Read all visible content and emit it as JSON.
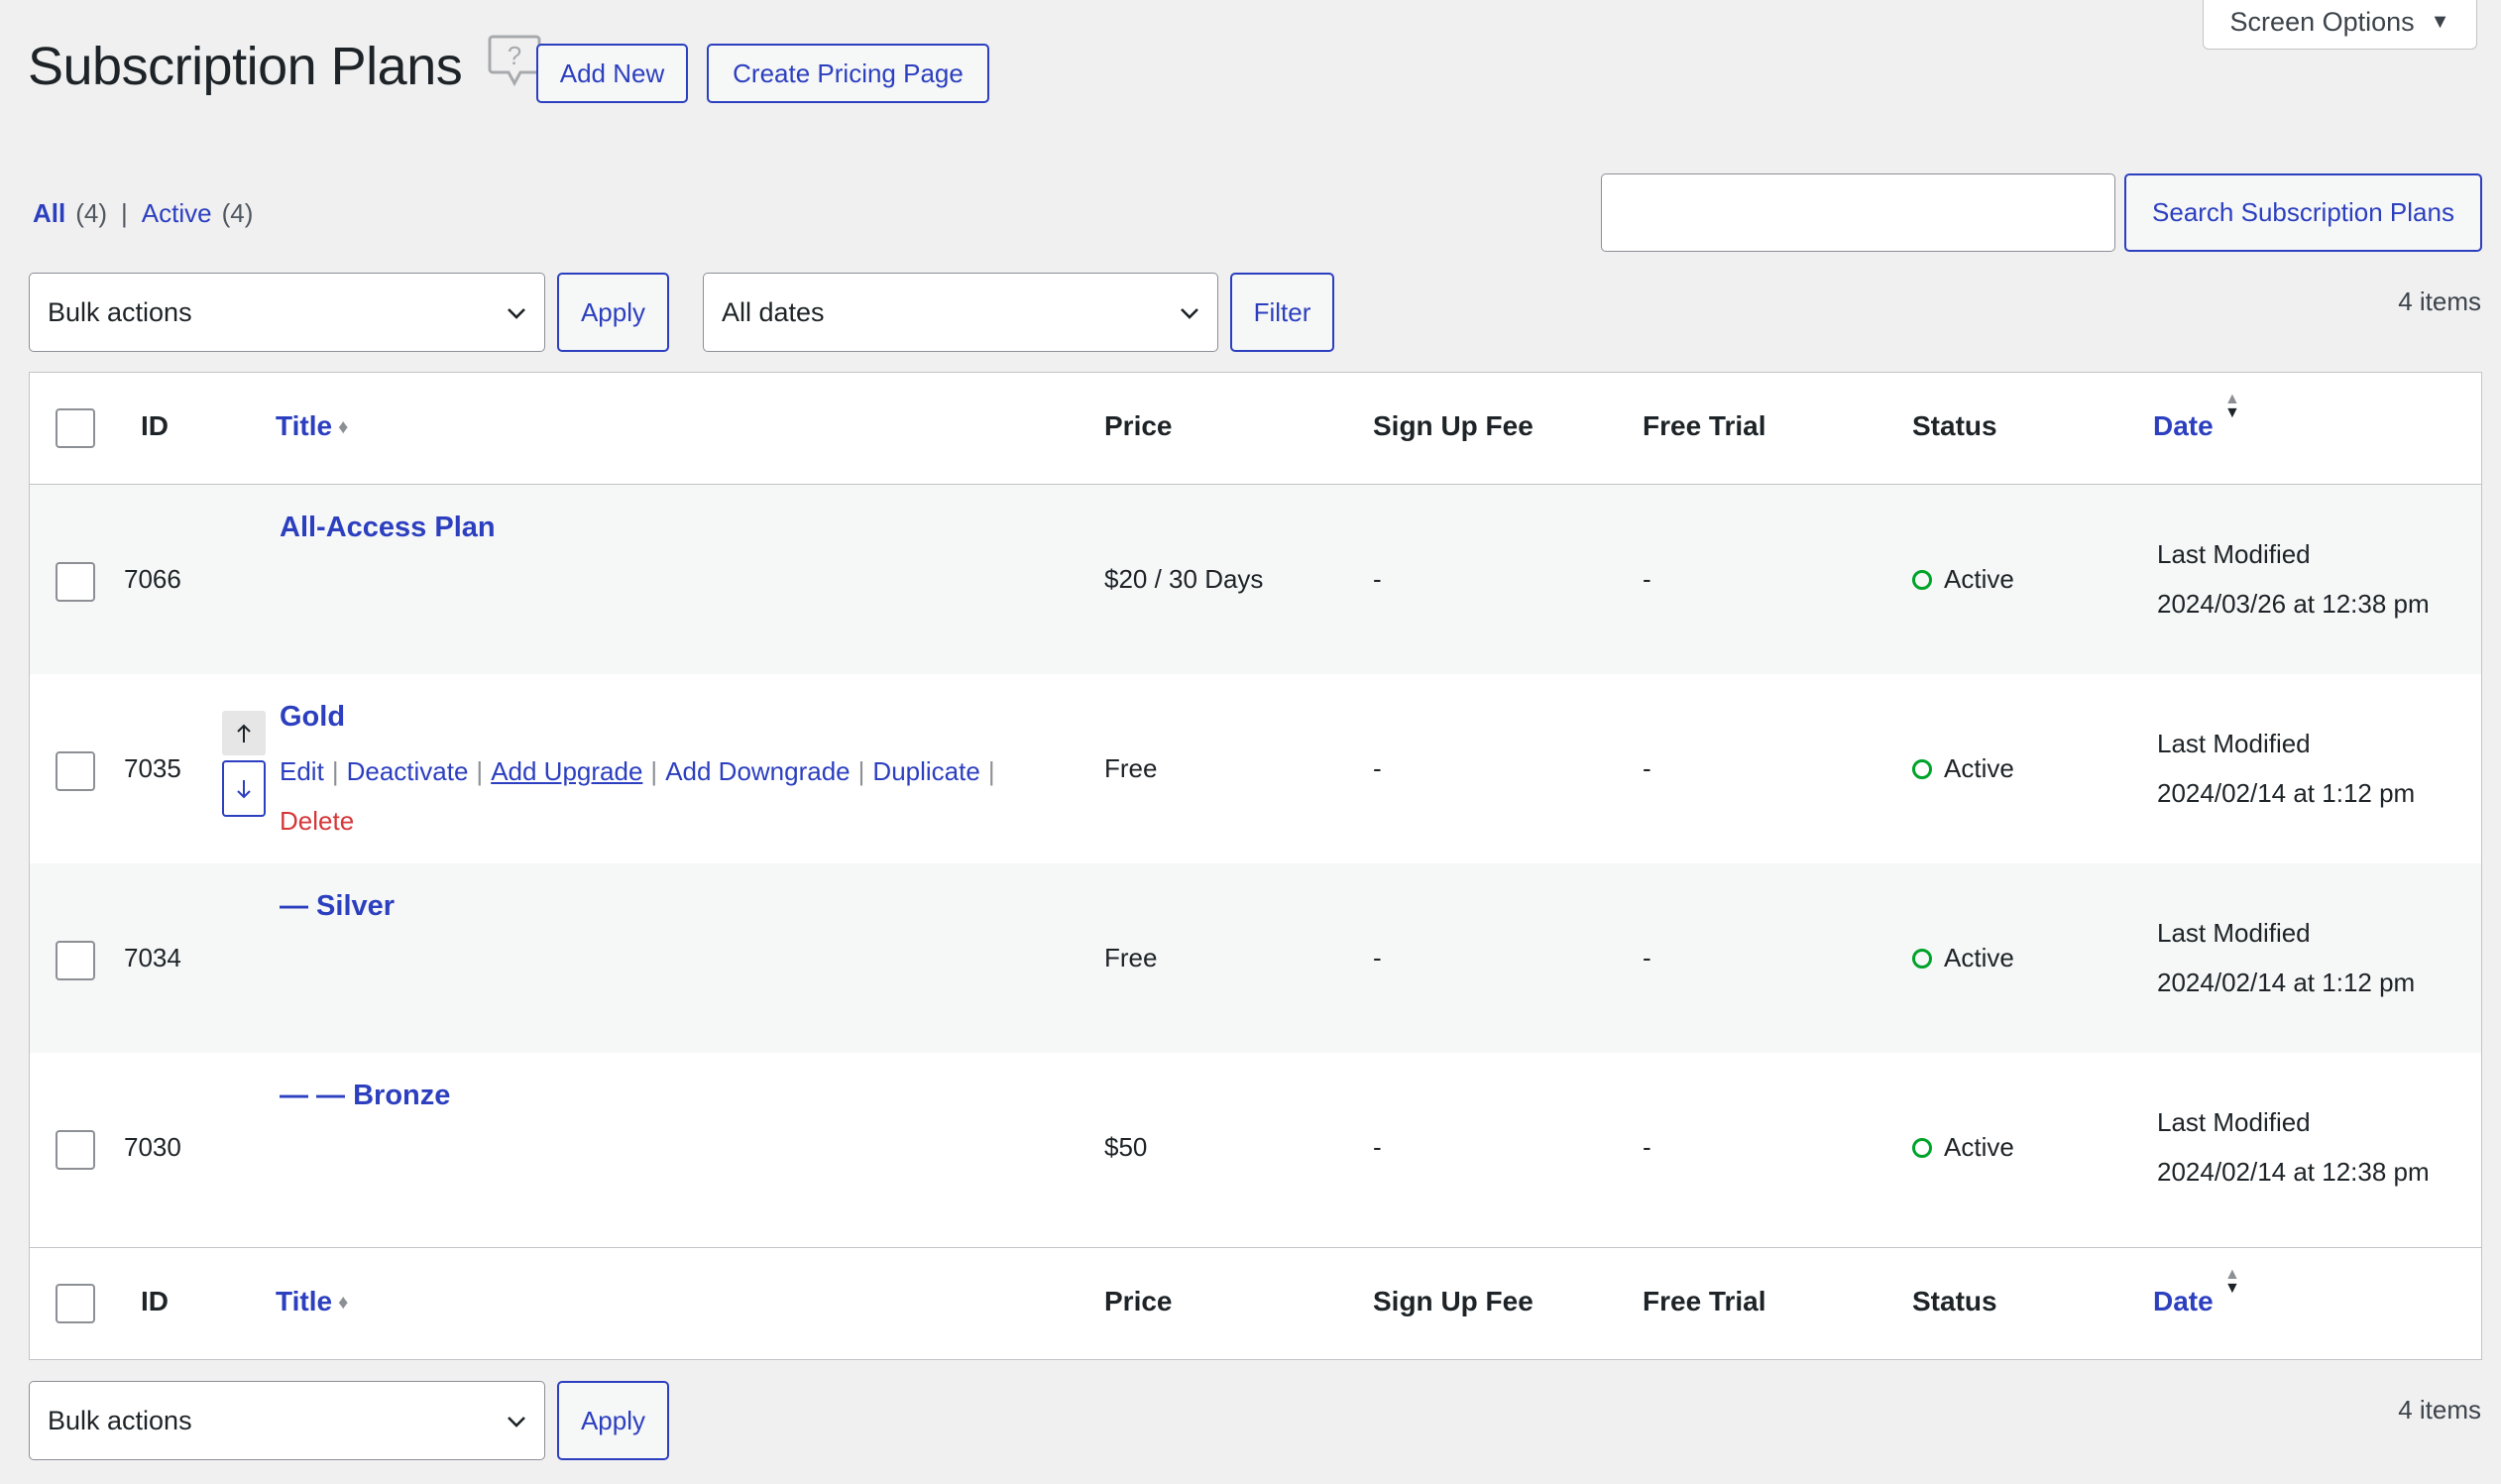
{
  "screen_options": {
    "label": "Screen Options"
  },
  "header": {
    "title": "Subscription Plans",
    "add_new": "Add New",
    "create_pricing": "Create Pricing Page"
  },
  "views": {
    "all_label": "All",
    "all_count": "(4)",
    "separator": "|",
    "active_label": "Active",
    "active_count": "(4)"
  },
  "search": {
    "value": "",
    "button": "Search Subscription Plans"
  },
  "toolbar": {
    "bulk_actions": "Bulk actions",
    "apply": "Apply",
    "dates": "All dates",
    "filter": "Filter",
    "items": "4 items"
  },
  "columns": {
    "id": "ID",
    "title": "Title",
    "price": "Price",
    "sign_up_fee": "Sign Up Fee",
    "free_trial": "Free Trial",
    "status": "Status",
    "date": "Date"
  },
  "rows": [
    {
      "id": "7066",
      "title": "All-Access Plan",
      "price": "$20 / 30 Days",
      "fee": "-",
      "trial": "-",
      "status": "Active",
      "date_label": "Last Modified",
      "date": "2024/03/26 at 12:38 pm"
    },
    {
      "id": "7035",
      "title": "Gold",
      "price": "Free",
      "fee": "-",
      "trial": "-",
      "status": "Active",
      "date_label": "Last Modified",
      "date": "2024/02/14 at 1:12 pm"
    },
    {
      "id": "7034",
      "title": "— Silver",
      "price": "Free",
      "fee": "-",
      "trial": "-",
      "status": "Active",
      "date_label": "Last Modified",
      "date": "2024/02/14 at 1:12 pm"
    },
    {
      "id": "7030",
      "title": "— — Bronze",
      "price": "$50",
      "fee": "-",
      "trial": "-",
      "status": "Active",
      "date_label": "Last Modified",
      "date": "2024/02/14 at 12:38 pm"
    }
  ],
  "row_actions": {
    "edit": "Edit",
    "deactivate": "Deactivate",
    "add_upgrade": "Add Upgrade",
    "add_downgrade": "Add Downgrade",
    "duplicate": "Duplicate",
    "delete": "Delete",
    "separator": "|"
  },
  "icons": {
    "help": "help-icon",
    "move_up": "arrow-up-icon",
    "move_down": "arrow-down-icon",
    "chevron": "chevron-down-icon",
    "status": "status-circle-icon"
  },
  "colors": {
    "accent": "#2c3fbf",
    "active_status": "#00a32a",
    "delete": "#d63638",
    "background": "#f0f0f1"
  }
}
